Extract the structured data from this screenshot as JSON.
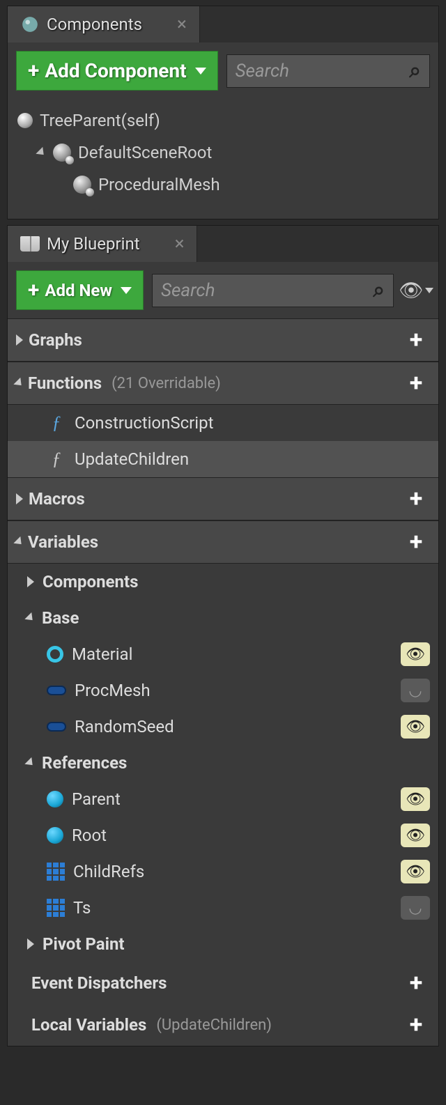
{
  "components_panel": {
    "title": "Components",
    "add_button": "Add Component",
    "search_placeholder": "Search",
    "tree": {
      "root": "TreeParent(self)",
      "scene_root": "DefaultSceneRoot",
      "child1": "ProceduralMesh"
    }
  },
  "blueprint_panel": {
    "title": "My Blueprint",
    "add_button": "Add New",
    "search_placeholder": "Search",
    "sections": {
      "graphs": {
        "label": "Graphs"
      },
      "functions": {
        "label": "Functions",
        "note": "(21 Overridable)",
        "items": [
          {
            "name": "ConstructionScript"
          },
          {
            "name": "UpdateChildren"
          }
        ]
      },
      "macros": {
        "label": "Macros"
      },
      "variables": {
        "label": "Variables",
        "groups": {
          "components": {
            "label": "Components"
          },
          "base": {
            "label": "Base",
            "items": [
              {
                "name": "Material",
                "icon": "ring",
                "visible": true
              },
              {
                "name": "ProcMesh",
                "icon": "pill",
                "visible": false
              },
              {
                "name": "RandomSeed",
                "icon": "pill",
                "visible": true
              }
            ]
          },
          "references": {
            "label": "References",
            "items": [
              {
                "name": "Parent",
                "icon": "ball",
                "visible": true
              },
              {
                "name": "Root",
                "icon": "ball",
                "visible": true
              },
              {
                "name": "ChildRefs",
                "icon": "grid",
                "visible": true
              },
              {
                "name": "Ts",
                "icon": "grid",
                "visible": false
              }
            ]
          },
          "pivot_paint": {
            "label": "Pivot Paint"
          }
        }
      },
      "event_dispatchers": {
        "label": "Event Dispatchers"
      },
      "local_variables": {
        "label": "Local Variables",
        "note": "(UpdateChildren)"
      }
    }
  }
}
